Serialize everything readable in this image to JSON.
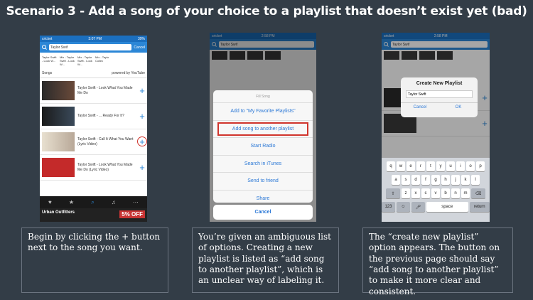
{
  "title": "Scenario 3 - Add a song of your choice to a playlist that doesn’t exist yet (bad)",
  "panel1": {
    "carrier": "cricket",
    "time": "3:07 PM",
    "battery": "39%",
    "search_value": "Taylor Swif",
    "cancel": "Cancel",
    "tile_captions": [
      "Taylor Swift - Look W...",
      "Mix - Taylor Swift - Look W...",
      "Mix - Taylor Swift - Look W...",
      "Mix - Taylo Collec"
    ],
    "songs_label": "Songs",
    "powered_by": "powered by YouTube",
    "rows": [
      {
        "title": "Taylor Swift - Look What You Made Me Do"
      },
      {
        "title": "Taylor Swift - ... Ready For It?"
      },
      {
        "title": "Taylor Swift - Call It What You Want (Lyric Video)"
      },
      {
        "title": "Taylor Swift - Look What You Made Me Do (Lyric Video)"
      }
    ],
    "tabs": [
      "Favorites",
      "Top Charts",
      "Search",
      "Music",
      "Other"
    ],
    "ad_left": "Urban Outfitters",
    "ad_right": "5% OFF"
  },
  "panel2": {
    "carrier": "cricket",
    "time": "2:58 PM",
    "search_value": "Taylor Swif",
    "sheet_header": "Fill Song",
    "options": [
      "Add to \"My Favorite Playlists\"",
      "Add song to another playlist",
      "Start Radio",
      "Search in iTunes",
      "Send to friend",
      "Share"
    ],
    "cancel": "Cancel"
  },
  "panel3": {
    "carrier": "cricket",
    "time": "2:58 PM",
    "search_value": "Taylor Swif",
    "dialog_title": "Create New Playlist",
    "dialog_input": "Taylor Swift",
    "dialog_cancel": "Cancel",
    "dialog_ok": "OK",
    "kb_row1": [
      "q",
      "w",
      "e",
      "r",
      "t",
      "y",
      "u",
      "i",
      "o",
      "p"
    ],
    "kb_row2": [
      "a",
      "s",
      "d",
      "f",
      "g",
      "h",
      "j",
      "k",
      "l"
    ],
    "kb_row3": [
      "z",
      "x",
      "c",
      "v",
      "b",
      "n",
      "m"
    ],
    "kb_123": "123",
    "kb_space": "space",
    "kb_return": "return"
  },
  "captions": [
    "Begin by clicking the + button next to the song you want.",
    "You’re given an ambiguous list of options. Creating a new playlist is listed as “add song to another playlist”, which is an unclear way of labeling it.",
    "The “create new playlist” option appears. The button on the previous page should say “add song to another playlist” to make it more clear and consistent."
  ]
}
